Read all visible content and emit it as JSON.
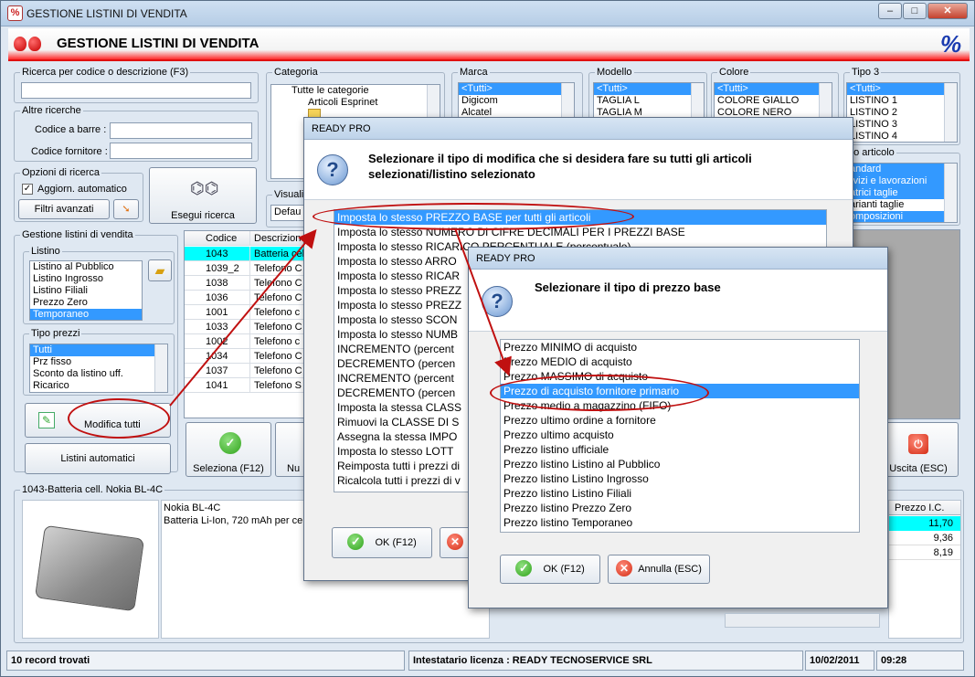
{
  "window": {
    "title": "GESTIONE LISTINI DI VENDITA",
    "icon": "percent-icon",
    "controls": [
      "minimize",
      "maximize",
      "close"
    ]
  },
  "banner": {
    "title": "GESTIONE LISTINI DI VENDITA",
    "icon": "strawberry-icon",
    "badge": "%"
  },
  "search": {
    "label": "Ricerca per codice o descrizione (F3)",
    "value": ""
  },
  "altre": {
    "label": "Altre ricerche",
    "barcode_label": "Codice a barre :",
    "supplier_label": "Codice fornitore :"
  },
  "opzioni": {
    "label": "Opzioni di ricerca",
    "auto_label": "Aggiorn. automatico",
    "auto_checked": true,
    "filters_label": "Filtri avanzati"
  },
  "esegui": {
    "label": "Esegui ricerca",
    "icon": "binoculars-icon"
  },
  "categoria": {
    "label": "Categoria",
    "items": [
      "Tutte le categorie",
      "Articoli Esprinet",
      "",
      "",
      "",
      ""
    ]
  },
  "visual": {
    "label": "Visuali",
    "value": "Defau"
  },
  "marca": {
    "label": "Marca",
    "items": [
      "<Tutti>",
      "Digicom",
      "Alcatel"
    ]
  },
  "modello": {
    "label": "Modello",
    "items": [
      "<Tutti>",
      "TAGLIA L",
      "TAGLIA M"
    ]
  },
  "colore": {
    "label": "Colore",
    "items": [
      "<Tutti>",
      "COLORE GIALLO",
      "COLORE NERO"
    ]
  },
  "tipo3": {
    "label": "Tipo 3",
    "items": [
      "<Tutti>",
      "LISTINO 1",
      "LISTINO 2",
      "LISTINO 3",
      "LISTINO 4"
    ]
  },
  "tipoart": {
    "label": "po articolo",
    "items": [
      "andard",
      "rvizi e lavorazioni",
      "atrici taglie",
      "arianti taglie",
      "omposizioni"
    ]
  },
  "gestione": {
    "label": "Gestione listini di vendita",
    "listino_label": "Listino",
    "listini": [
      "Listino al Pubblico",
      "Listino Ingrosso",
      "Listino Filiali",
      "Prezzo Zero",
      "Temporaneo"
    ],
    "tipo_prezzi_label": "Tipo prezzi",
    "tipi": [
      "Tutti",
      "Prz fisso",
      "Sconto da listino uff.",
      "Ricarico"
    ],
    "modifica_label": "Modifica tutti",
    "automatici_label": "Listini automatici"
  },
  "grid": {
    "headers": [
      "Codice",
      "Descrizione"
    ],
    "rows": [
      [
        "1043",
        "Batteria cell"
      ],
      [
        "1039_2",
        "Telefono C"
      ],
      [
        "1038",
        "Telefono C"
      ],
      [
        "1036",
        "Telefono C"
      ],
      [
        "1001",
        "Telefono c"
      ],
      [
        "1033",
        "Telefono C"
      ],
      [
        "1002",
        "Telefono c"
      ],
      [
        "1034",
        "Telefono C"
      ],
      [
        "1037",
        "Telefono C"
      ],
      [
        "1041",
        "Telefono S"
      ]
    ]
  },
  "actions": {
    "seleziona": "Seleziona (F12)",
    "nu": "Nu",
    "uscita": "Uscita (ESC)"
  },
  "detail": {
    "label": "1043-Batteria cell. Nokia BL-4C",
    "line1": "Nokia BL-4C",
    "line2": "Batteria Li-Ion, 720 mAh per cell",
    "price_header": "Prezzo I.C.",
    "prices": [
      "11,70",
      "9,36",
      "8,19"
    ]
  },
  "status": {
    "records": "10 record trovati",
    "license": "Intestatario licenza : READY TECNOSERVICE SRL",
    "date": "10/02/2011",
    "time": "09:28"
  },
  "dialog1": {
    "title": "READY PRO",
    "message": "Selezionare il tipo di modifica che si desidera fare su tutti gli articoli selezionati/listino selezionato",
    "items": [
      "Imposta lo stesso PREZZO BASE per tutti gli articoli",
      "Imposta lo stesso NUMERO DI CIFRE DECIMALI PER I PREZZI BASE",
      "Imposta lo stesso RICARICO PERCENTUALE (percentuale)",
      "Imposta lo stesso ARRO",
      "Imposta lo stesso RICAR",
      "Imposta lo stesso PREZZ",
      "Imposta lo stesso PREZZ",
      "Imposta lo stesso SCON",
      "Imposta lo stesso NUMB",
      "INCREMENTO (percent",
      "DECREMENTO (percen",
      "INCREMENTO (percent",
      "DECREMENTO (percen",
      "Imposta la stessa CLASS",
      "Rimuovi la CLASSE DI S",
      "Assegna la stessa IMPO",
      "Imposta lo stesso LOTT",
      "Reimposta tutti i prezzi di",
      "Ricalcola tutti i prezzi di v"
    ],
    "selected": 0,
    "ok": "OK (F12)"
  },
  "dialog2": {
    "title": "READY PRO",
    "message": "Selezionare il tipo di prezzo base",
    "items": [
      "Prezzo MINIMO di acquisto",
      "Prezzo MEDIO di acquisto",
      "Prezzo MASSIMO di acquisto",
      "Prezzo di acquisto fornitore primario",
      "Prezzo medio a magazzino (FIFO)",
      "Prezzo ultimo ordine a fornitore",
      "Prezzo ultimo acquisto",
      "Prezzo listino ufficiale",
      "Prezzo listino Listino al Pubblico",
      "Prezzo listino Listino Ingrosso",
      "Prezzo listino Listino Filiali",
      "Prezzo listino Prezzo Zero",
      "Prezzo listino Temporaneo"
    ],
    "selected": 3,
    "ok": "OK (F12)",
    "cancel": "Annulla (ESC)"
  },
  "colors": {
    "selection": "#3399ff",
    "highlight_oval": "#c01010",
    "banner_red": "#e01010",
    "grid_selected": "#00ffff"
  }
}
